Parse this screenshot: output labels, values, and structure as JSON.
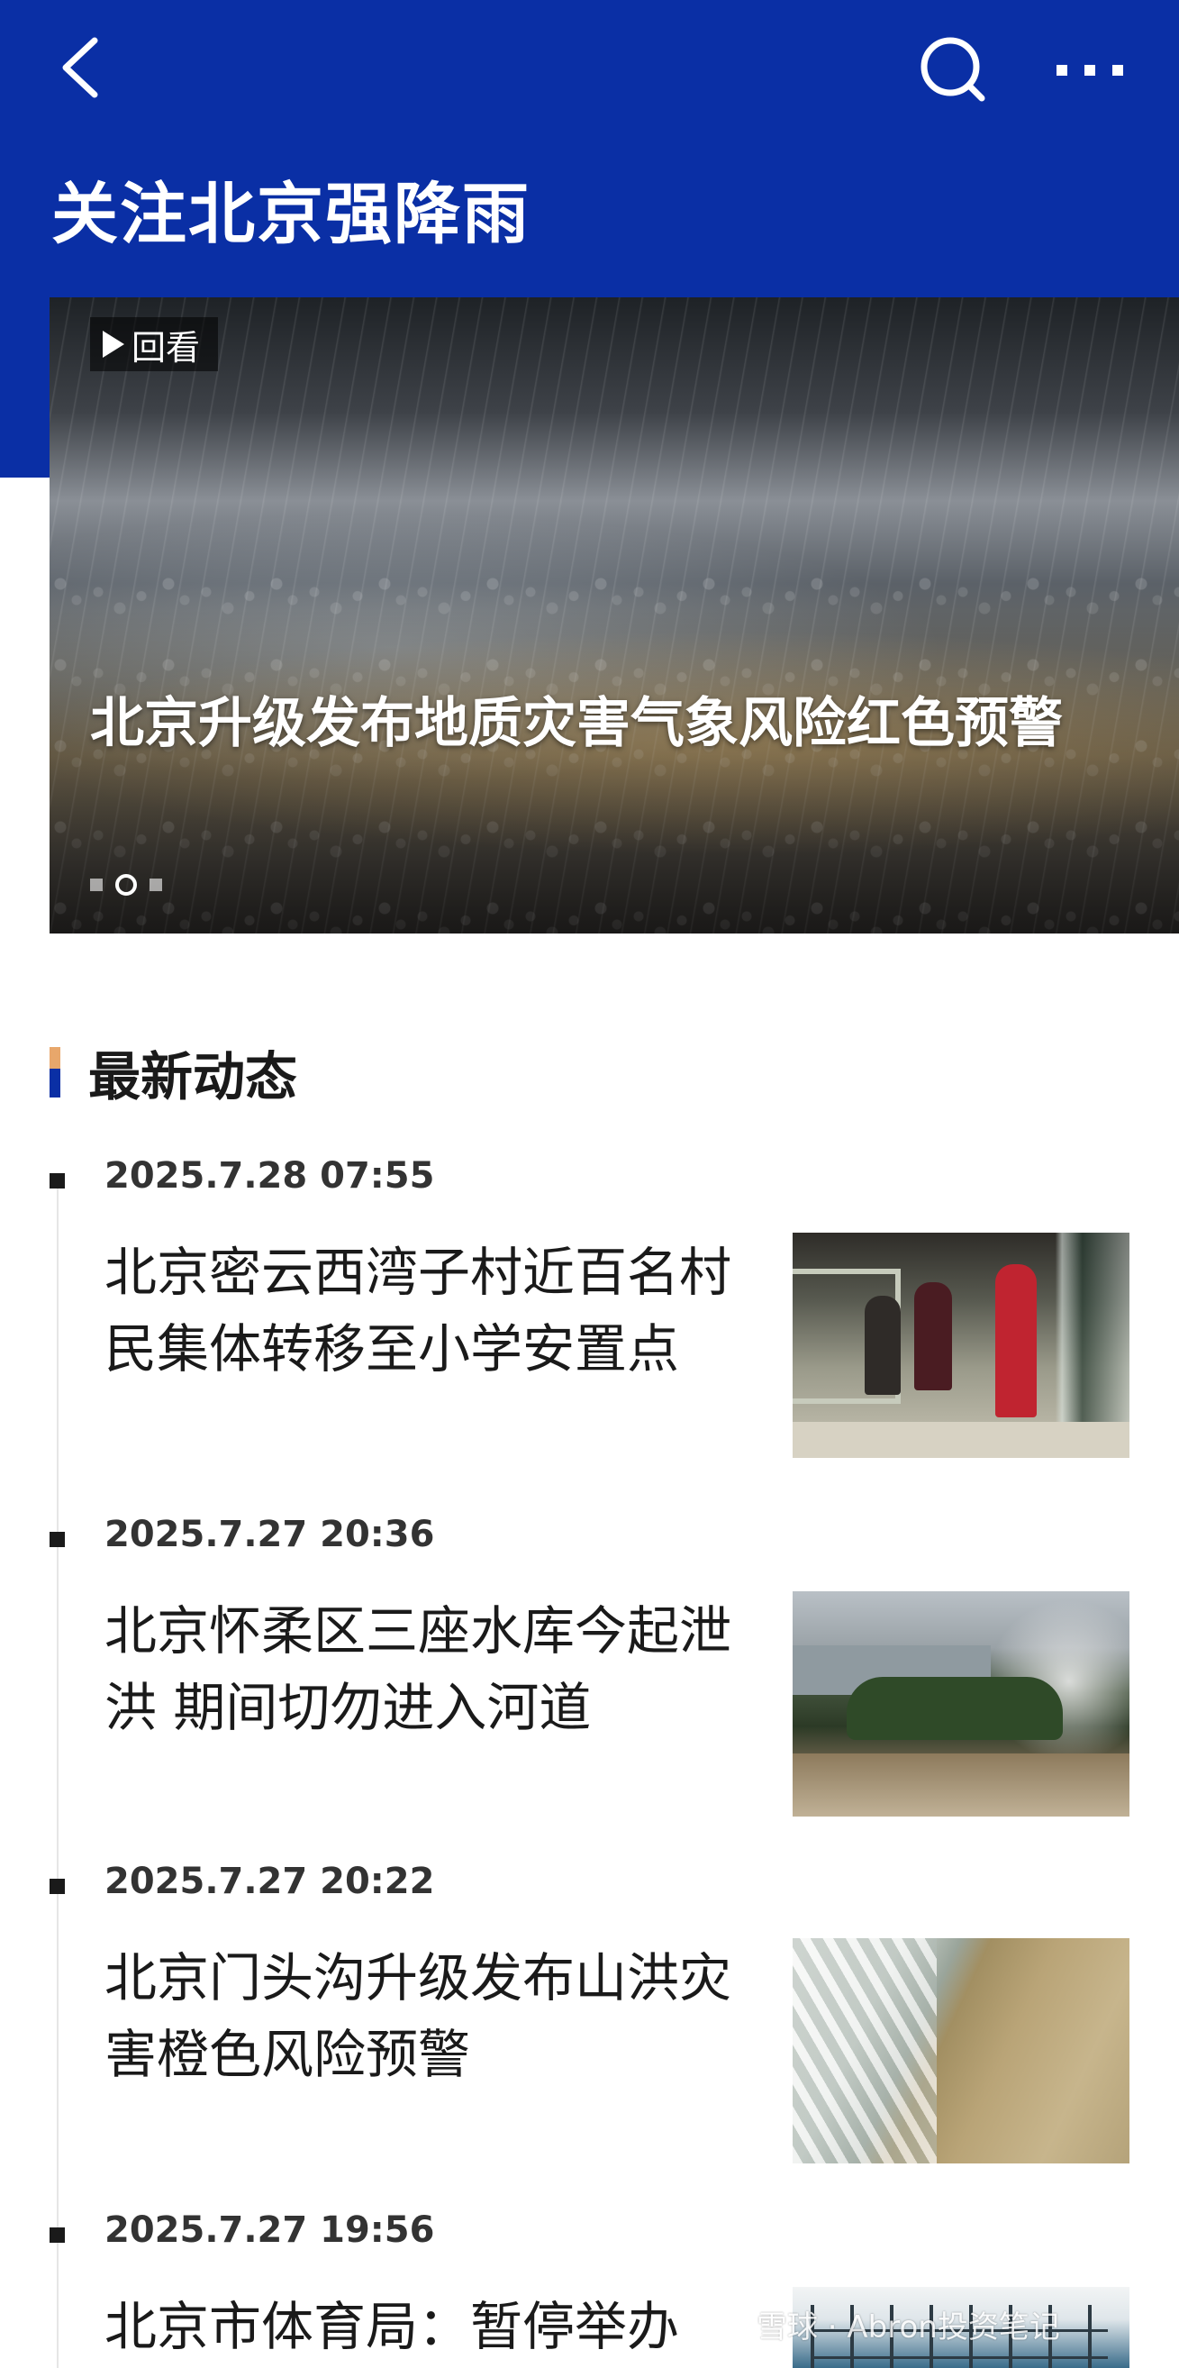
{
  "header": {
    "title": "关注北京强降雨",
    "back_icon": "chevron-left-icon",
    "search_icon": "search-icon",
    "more_icon": "more-horizontal-icon",
    "background_color": "#0a2fa5"
  },
  "hero": {
    "badge_label": "回看",
    "headline": "北京升级发布地质灾害气象风险红色预警",
    "active_slide": 2,
    "slide_count": 3
  },
  "section": {
    "title": "最新动态"
  },
  "news": [
    {
      "time": "2025.7.28 07:55",
      "title": "北京密云西湾子村近百名村民集体转移至小学安置点"
    },
    {
      "time": "2025.7.27 20:36",
      "title": "北京怀柔区三座水库今起泄洪 期间切勿进入河道"
    },
    {
      "time": "2025.7.27 20:22",
      "title": "北京门头沟升级发布山洪灾害橙色风险预警"
    },
    {
      "time": "2025.7.27 19:56",
      "title": "北京市体育局：暂停举办"
    }
  ],
  "watermark": "雪球 · Abron投资笔记"
}
